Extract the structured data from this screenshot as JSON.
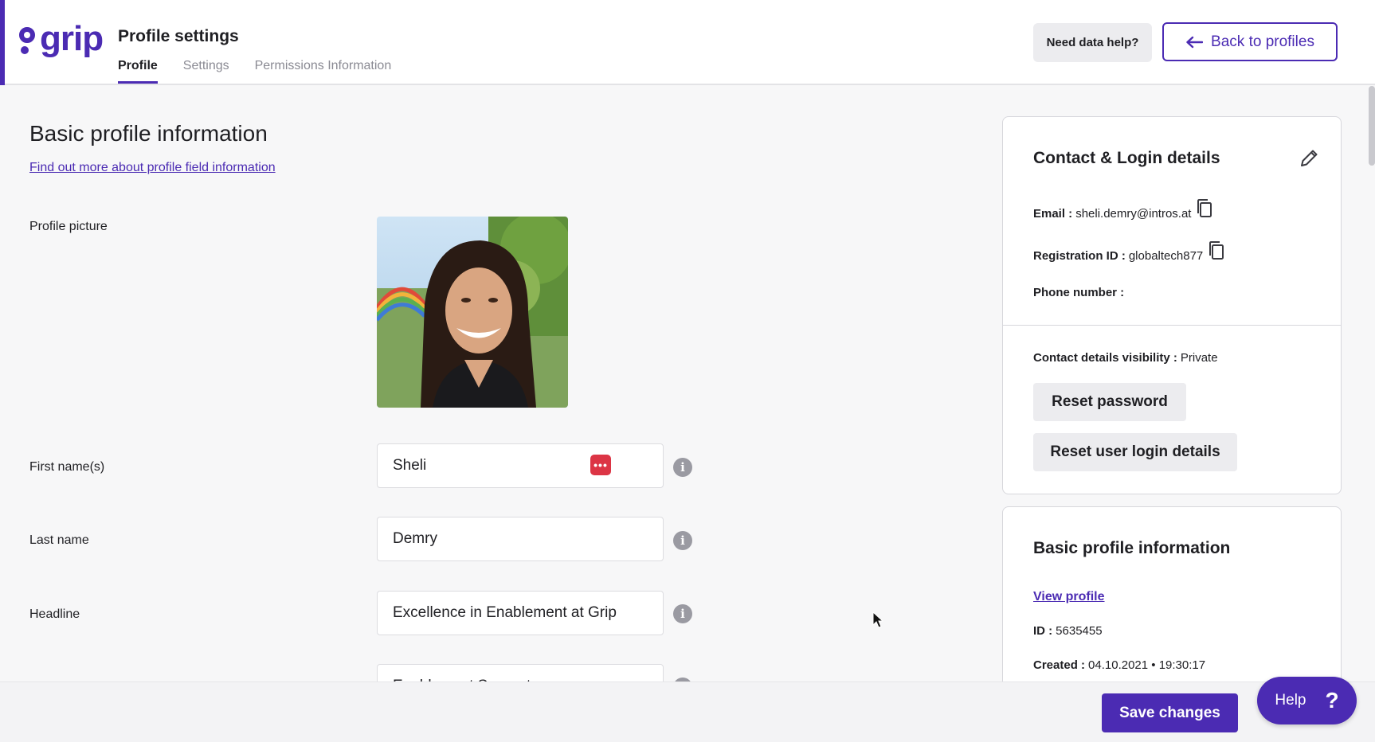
{
  "header": {
    "logo_text": "grip",
    "page_title": "Profile settings",
    "tabs": [
      {
        "label": "Profile",
        "active": true
      },
      {
        "label": "Settings",
        "active": false
      },
      {
        "label": "Permissions Information",
        "active": false
      }
    ],
    "need_help_label": "Need data help?",
    "back_label": "Back to profiles"
  },
  "main": {
    "section_title": "Basic profile information",
    "info_link": "Find out more about profile field information",
    "profile_picture_label": "Profile picture",
    "fields": [
      {
        "label": "First name(s)",
        "value": "Sheli"
      },
      {
        "label": "Last name",
        "value": "Demry"
      },
      {
        "label": "Headline",
        "value": "Excellence in Enablement at  Grip"
      },
      {
        "label": "",
        "value": "Enablement Support"
      }
    ],
    "badge_glyph": "•••",
    "info_glyph": "i"
  },
  "contact_card": {
    "title": "Contact & Login details",
    "email_label": "Email :",
    "email_value": "sheli.demry@intros.at",
    "registration_label": "Registration ID :",
    "registration_value": "globaltech877",
    "phone_label": "Phone number :",
    "phone_value": "",
    "visibility_label": "Contact details visibility :",
    "visibility_value": "Private",
    "reset_password_label": "Reset password",
    "reset_login_label": "Reset user login details"
  },
  "basic_card": {
    "title": "Basic profile information",
    "view_profile_link": "View profile",
    "id_label": "ID :",
    "id_value": "5635455",
    "created_label": "Created :",
    "created_value": "04.10.2021 • 19:30:17"
  },
  "footer": {
    "save_label": "Save changes",
    "help_label": "Help",
    "help_glyph": "?"
  },
  "colors": {
    "brand": "#4b2bb3",
    "danger": "#dc3545"
  },
  "icons": [
    "arrow-left-icon",
    "pencil-icon",
    "copy-icon",
    "info-icon",
    "more-icon",
    "question-icon"
  ]
}
